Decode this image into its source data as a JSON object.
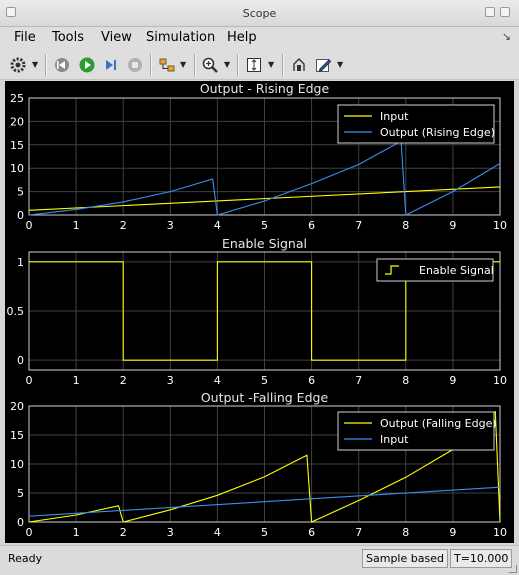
{
  "window": {
    "title": "Scope"
  },
  "menu": [
    "File",
    "Tools",
    "View",
    "Simulation",
    "Help"
  ],
  "toolbar": {
    "icons": [
      "gear-icon",
      "step-back-icon",
      "run-icon",
      "step-forward-icon",
      "stop-icon",
      "signal-select-icon",
      "zoom-icon",
      "scale-axes-icon",
      "highlight-block-icon",
      "edit-parameters-icon"
    ]
  },
  "colors": {
    "yellow": "#ffff00",
    "blue": "#3c8ef0",
    "background": "#000000",
    "axes": "#ffffff",
    "grid": "#404040"
  },
  "chart_data": [
    {
      "type": "line",
      "title": "Output - Rising Edge",
      "xlim": [
        0,
        10
      ],
      "ylim": [
        0,
        25
      ],
      "xticks": [
        0,
        1,
        2,
        3,
        4,
        5,
        6,
        7,
        8,
        9,
        10
      ],
      "yticks": [
        0,
        5,
        10,
        15,
        20,
        25
      ],
      "grid": true,
      "legend_position": "top-right",
      "series": [
        {
          "name": "Input",
          "color": "#ffff00",
          "x": [
            0,
            10
          ],
          "y": [
            1,
            6
          ]
        },
        {
          "name": "Output (Rising Edge)",
          "color": "#3c8ef0",
          "x": [
            0,
            1,
            2,
            3,
            3.9,
            4,
            5,
            6,
            7,
            7.9,
            8,
            9,
            10
          ],
          "y": [
            0,
            1.2,
            2.8,
            5,
            7.7,
            0,
            3,
            6.7,
            10.8,
            15.8,
            0,
            5,
            11
          ]
        }
      ]
    },
    {
      "type": "line",
      "title": "Enable Signal",
      "xlim": [
        0,
        10
      ],
      "ylim": [
        -0.1,
        1.1
      ],
      "xticks": [
        0,
        1,
        2,
        3,
        4,
        5,
        6,
        7,
        8,
        9,
        10
      ],
      "yticks": [
        "0",
        "0.5",
        "1"
      ],
      "grid": true,
      "legend_position": "top-right",
      "series": [
        {
          "name": "Enable Signal",
          "color": "#ffff00",
          "step": true,
          "x": [
            0,
            2,
            2,
            4,
            4,
            6,
            6,
            8,
            8,
            10
          ],
          "y": [
            1,
            1,
            0,
            0,
            1,
            1,
            0,
            0,
            1,
            1
          ]
        }
      ]
    },
    {
      "type": "line",
      "title": "Output -Falling Edge",
      "xlim": [
        0,
        10
      ],
      "ylim": [
        0,
        20
      ],
      "xticks": [
        0,
        1,
        2,
        3,
        4,
        5,
        6,
        7,
        8,
        9,
        10
      ],
      "yticks": [
        0,
        5,
        10,
        15,
        20
      ],
      "grid": true,
      "legend_position": "top-right",
      "series": [
        {
          "name": "Output (Falling Edge)",
          "color": "#ffff00",
          "x": [
            0,
            1,
            1.9,
            2,
            3,
            4,
            5,
            5.9,
            6,
            7,
            8,
            9,
            9.9,
            10
          ],
          "y": [
            0,
            1.2,
            2.8,
            0,
            2.1,
            4.6,
            7.8,
            11.5,
            0,
            3.7,
            7.7,
            12.5,
            19,
            0
          ]
        },
        {
          "name": "Input",
          "color": "#3c8ef0",
          "x": [
            0,
            10
          ],
          "y": [
            1,
            6
          ]
        }
      ]
    }
  ],
  "status": {
    "ready": "Ready",
    "mode": "Sample based",
    "time": "T=10.000"
  }
}
